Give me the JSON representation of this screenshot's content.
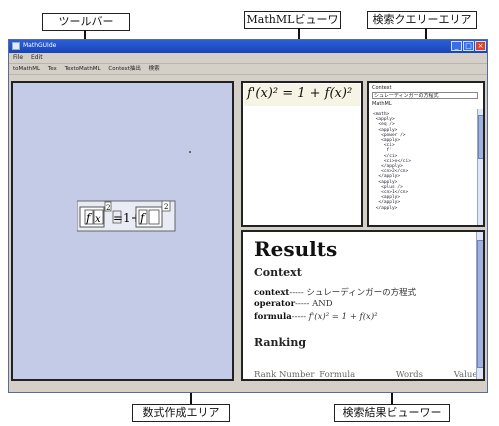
{
  "callouts": {
    "toolbar": "ツールバー",
    "mathml_viewer": "MathMLビューワ",
    "query_area": "検索クエリーエリア",
    "editor_area": "数式作成エリア",
    "results_viewer": "検索結果ビューワー"
  },
  "window": {
    "title": "MathGUIde",
    "menu": [
      "File",
      "Edit"
    ],
    "toolbar": [
      "toMathML",
      "Tex",
      "TextoMathML",
      "Context抽出",
      "検索"
    ]
  },
  "viewer": {
    "formula_text": "f'(x)² = 1 + f(x)²"
  },
  "query": {
    "context_label": "Context",
    "context_value": "シュレーディンガーの方程式",
    "mathml_label": "MathML",
    "mathml_lines": [
      "<math>",
      " <apply>",
      "  <eq />",
      "  <apply>",
      "   <power />",
      "   <apply>",
      "    <ci>",
      "     f'",
      "    </ci>",
      "    <ci>x</ci>",
      "   </apply>",
      "   <cn>2</cn>",
      "  </apply>",
      "  <apply>",
      "   <plus />",
      "   <cn>1</cn>",
      "   <apply>",
      "  </apply>",
      " </apply>"
    ]
  },
  "results": {
    "heading": "Results",
    "context_heading": "Context",
    "context_label": "context",
    "context_value": "シュレーディンガーの方程式",
    "operator_label": "operator",
    "operator_value": "AND",
    "formula_label": "formula",
    "formula_value": "f'(x)² = 1 + f(x)²",
    "ranking_heading": "Ranking",
    "columns": [
      "Rank Number",
      "Formula",
      "Words",
      "Value"
    ]
  },
  "colors": {
    "editor_bg": "#c3cbe7",
    "titlebar": "#2a5fd8",
    "window_bg": "#d4d0c8"
  }
}
